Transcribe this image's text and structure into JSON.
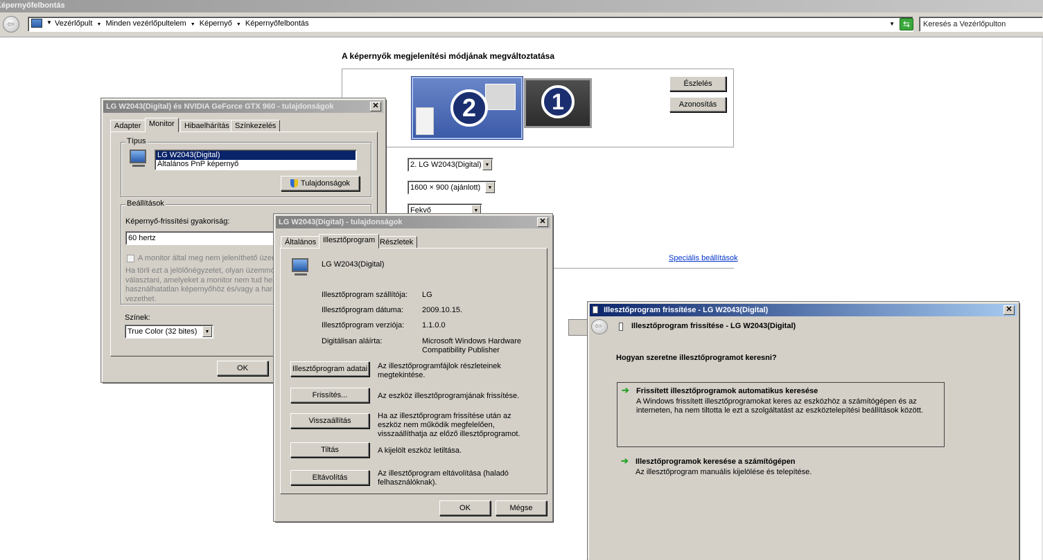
{
  "window_title": "Képernyőfelbontás",
  "address": {
    "crumbs": [
      "Vezérlőpult",
      "Minden vezérlőpultelem",
      "Képernyő",
      "Képernyőfelbontás"
    ],
    "search_placeholder": "Keresés a Vezérlőpulton"
  },
  "display_page": {
    "heading": "A képernyők megjelenítési módjának megváltoztatása",
    "monitors": [
      "2",
      "1"
    ],
    "detect_btn": "Észlelés",
    "identify_btn": "Azonosítás",
    "display_value": "2. LG W2043(Digital)",
    "resolution_value": "1600 × 900 (ajánlott)",
    "orientation_value": "Fekvő",
    "advanced_link": "Speciális beállítások"
  },
  "adapter_dialog": {
    "title": "LG W2043(Digital) és NVIDIA GeForce GTX 960 - tulajdonságok",
    "tabs": [
      "Adapter",
      "Monitor",
      "Hibaelhárítás",
      "Színkezelés"
    ],
    "type_group": "Típus",
    "monitor_list": [
      "LG W2043(Digital)",
      "Általános PnP képernyő"
    ],
    "properties_btn": "Tulajdonságok",
    "settings_group": "Beállítások",
    "refresh_label": "Képernyő-frissítési gyakoriság:",
    "refresh_value": "60 hertz",
    "hide_modes_label": "A monitor által meg nem jeleníthető üzem",
    "hide_modes_desc": [
      "Ha törli ezt a jelölőnégyzetet, olyan üzemmó",
      "választani, amelyeket a monitor nem tud hel",
      "használhatatlan képernyőhöz és/vagy a hard",
      "vezethet."
    ],
    "colors_label": "Színek:",
    "colors_value": "True Color (32 bites)",
    "ok": "OK"
  },
  "monitor_dialog": {
    "title": "LG W2043(Digital) - tulajdonságok",
    "tabs": [
      "Általános",
      "Illesztőprogram",
      "Részletek"
    ],
    "device_name": "LG W2043(Digital)",
    "props": [
      {
        "label": "Illesztőprogram szállítója:",
        "value": "LG"
      },
      {
        "label": "Illesztőprogram dátuma:",
        "value": "2009.10.15."
      },
      {
        "label": "Illesztőprogram verziója:",
        "value": "1.1.0.0"
      },
      {
        "label": "Digitálisan aláírta:",
        "value": "Microsoft Windows Hardware Compatibility Publisher"
      }
    ],
    "actions": [
      {
        "button": "Illesztőprogram adatai",
        "desc": "Az illesztőprogramfájlok részleteinek megtekintése."
      },
      {
        "button": "Frissítés...",
        "desc": "Az eszköz illesztőprogramjának frissítése."
      },
      {
        "button": "Visszaállítás",
        "desc": "Ha az illesztőprogram frissítése után az eszköz nem működik megfelelően, visszaállíthatja az előző illesztőprogramot."
      },
      {
        "button": "Tiltás",
        "desc": "A kijelölt eszköz letiltása."
      },
      {
        "button": "Eltávolítás",
        "desc": "Az illesztőprogram eltávolítása (haladó felhasználóknak)."
      }
    ],
    "ok": "OK",
    "cancel": "Mégse"
  },
  "update_dialog": {
    "title": "Illesztőprogram frissítése - LG W2043(Digital)",
    "header": "Illesztőprogram frissítése - LG W2043(Digital)",
    "question": "Hogyan szeretne illesztőprogramot keresni?",
    "option1_title": "Frissített illesztőprogramok automatikus keresése",
    "option1_desc": "A Windows frissített illesztőprogramokat keres az eszközhöz a számítógépen és az interneten, ha nem tiltotta le ezt a szolgáltatást az eszköztelepítési beállítások között.",
    "option2_title": "Illesztőprogramok keresése a számítógépen",
    "option2_desc": "Az illesztőprogram manuális kijelölése és telepítése."
  },
  "colors": {
    "accent_green": "#2aa32a",
    "selected_blue": "#0a246a",
    "monitor_blue": "#3b5aa8"
  }
}
